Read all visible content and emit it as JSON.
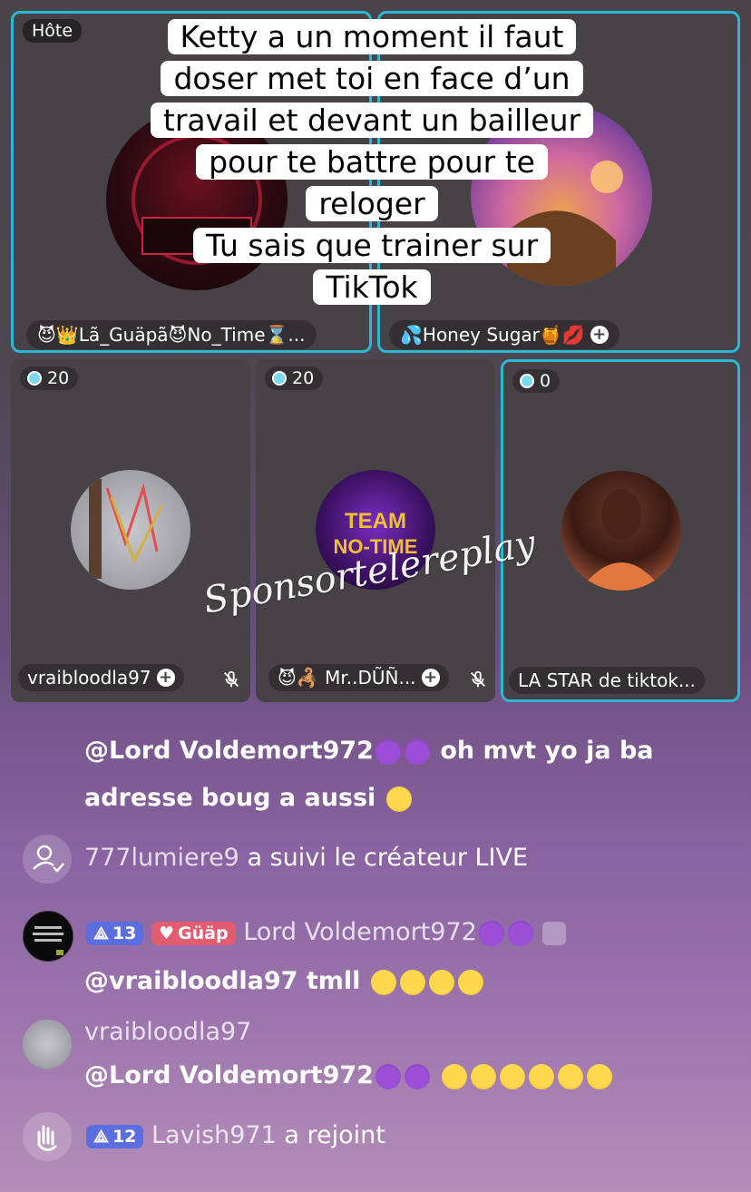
{
  "caption": {
    "lines": [
      "Ketty a un moment il faut",
      "doser met toi en face d’un",
      "travail et devant un bailleur",
      "pour te battre pour te",
      "reloger",
      "Tu sais que trainer sur",
      "TikTok"
    ]
  },
  "host_tile": {
    "badge": "Hôte",
    "name": "😈👑Lã_Guäpã😈No_Time⌛..."
  },
  "guest_tile": {
    "name": "💦Honey Sugar🍯💋"
  },
  "small_tiles": [
    {
      "score": "20",
      "name": "vraibloodla97"
    },
    {
      "score": "20",
      "name": "😈🦂 Mr..DŨÑ..."
    },
    {
      "score": "0",
      "name": "LA STAR de tiktok..."
    }
  ],
  "watermark": "Sponsortelereplay",
  "chat": {
    "msg1": {
      "text": "@Lord Voldemort972",
      "rest": " oh mvt yo ja ba",
      "line2": "adresse boug a aussi"
    },
    "follow": {
      "user": "777lumiere9",
      "text": " a suivi le créateur LIVE"
    },
    "msg2": {
      "level": "13",
      "fan_badge": "Güäp",
      "user": "Lord Voldemort972",
      "text": "@vraibloodla97 tmll"
    },
    "msg3": {
      "user": "vraibloodla97",
      "text": "@Lord Voldemort972"
    },
    "join": {
      "level": "12",
      "user": "Lavish971",
      "text": " a rejoint"
    }
  },
  "colors": {
    "active_border": "#2bb7d6",
    "tile_bg": "#474246",
    "level_badge": "#5b6ee0",
    "fan_badge": "#e25b6f"
  }
}
